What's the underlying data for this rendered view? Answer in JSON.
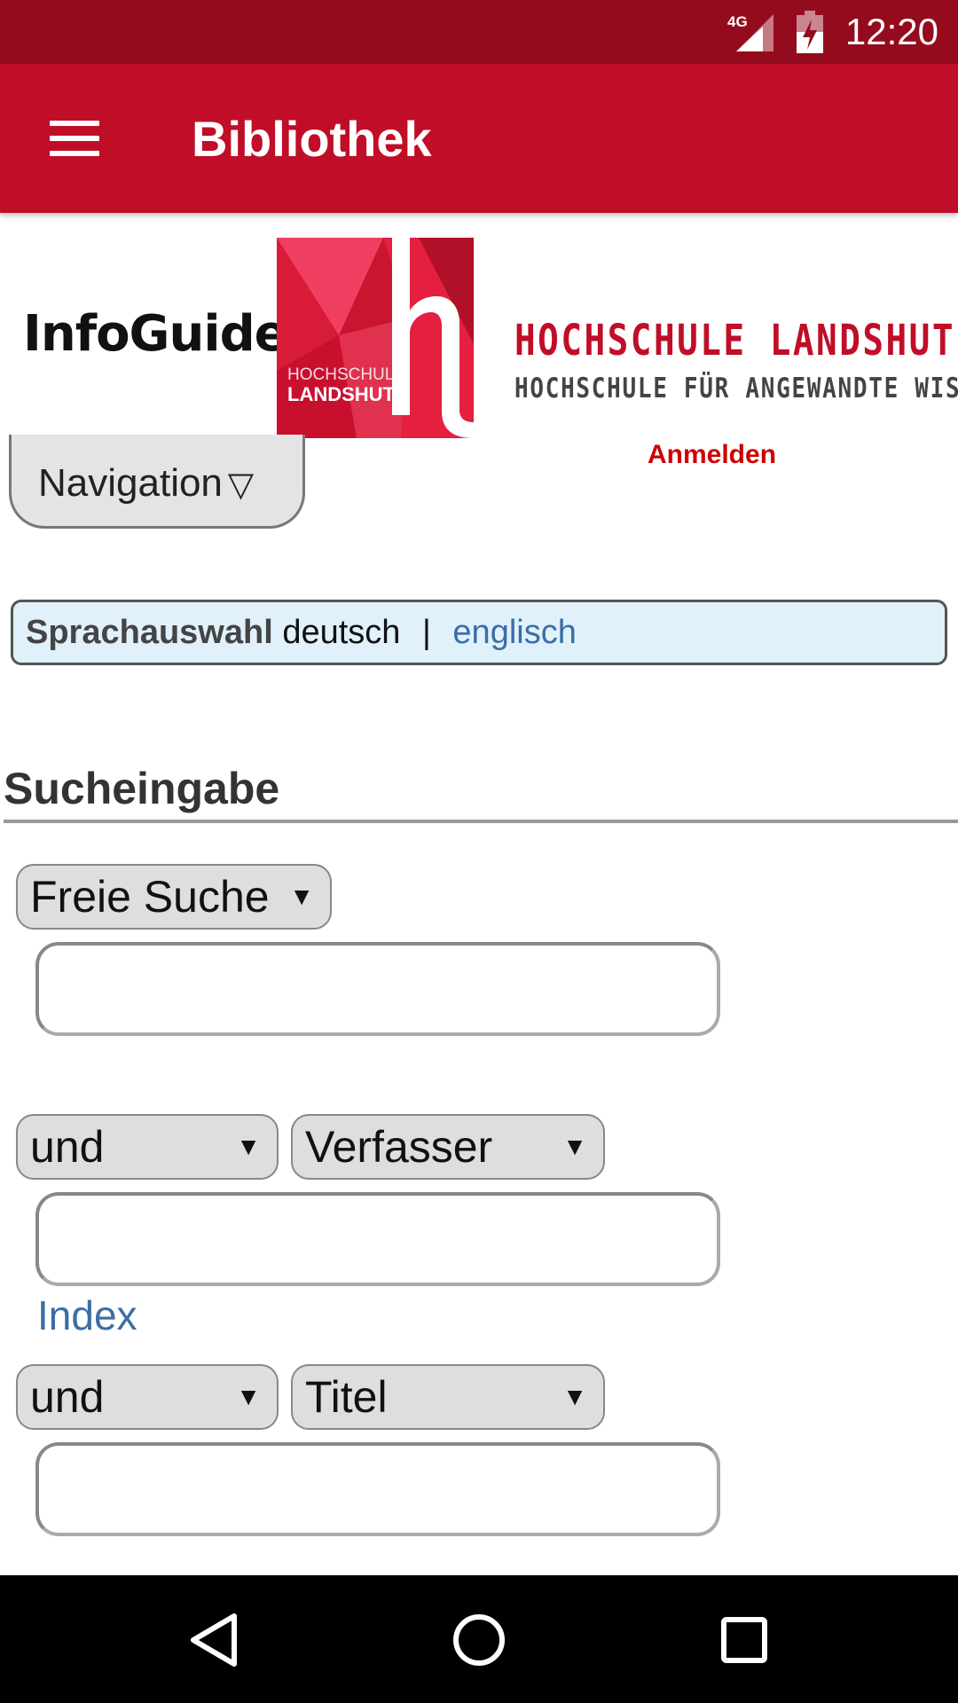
{
  "status_bar": {
    "network": "4G",
    "time": "12:20"
  },
  "app_bar": {
    "title": "Bibliothek",
    "menu_icon": "hamburger-menu-icon"
  },
  "header": {
    "infoguide_logo": "InfoGuide",
    "hs_logo_text_line1": "HOCHSCHULE",
    "hs_logo_text_line2": "LANDSHUT",
    "hs_name_main": "HOCHSCHULE LANDSHUT",
    "hs_name_sub": "HOCHSCHULE FÜR ANGEWANDTE WISSE",
    "login": "Anmelden"
  },
  "navigation": {
    "label": "Navigation",
    "arrow": "▽"
  },
  "language": {
    "label": "Sprachauswahl",
    "current": "deutsch",
    "separator": "|",
    "other": "englisch"
  },
  "search": {
    "heading": "Sucheingabe",
    "row1": {
      "field": "Freie Suche",
      "value": ""
    },
    "row2": {
      "operator": "und",
      "field": "Verfasser",
      "value": ""
    },
    "index_link": "Index",
    "row3": {
      "operator": "und",
      "field": "Titel",
      "value": ""
    }
  },
  "colors": {
    "status_bar": "#950b1e",
    "app_bar": "#c00e28",
    "link": "#3a6ea5",
    "login": "#cc0000",
    "lang_bg": "#e0f1fc"
  },
  "system_nav": {
    "back_icon": "back-triangle-icon",
    "home_icon": "home-circle-icon",
    "recents_icon": "recents-square-icon"
  }
}
